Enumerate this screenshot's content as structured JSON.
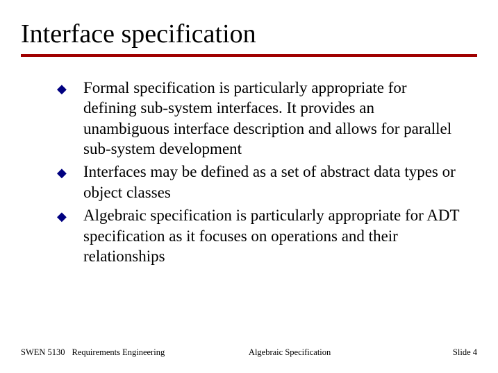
{
  "title": "Interface specification",
  "bullets": [
    "Formal specification is particularly appropriate for defining sub-system interfaces. It provides an unambiguous interface description and allows for parallel sub-system development",
    "Interfaces may be defined as a set of abstract data types or object classes",
    "Algebraic specification is particularly appropriate for ADT specification as it focuses on operations and their relationships"
  ],
  "footer": {
    "course_code": "SWEN 5130",
    "course_name": "Requirements Engineering",
    "center": "Algebraic Specification",
    "right": "Slide  4"
  }
}
